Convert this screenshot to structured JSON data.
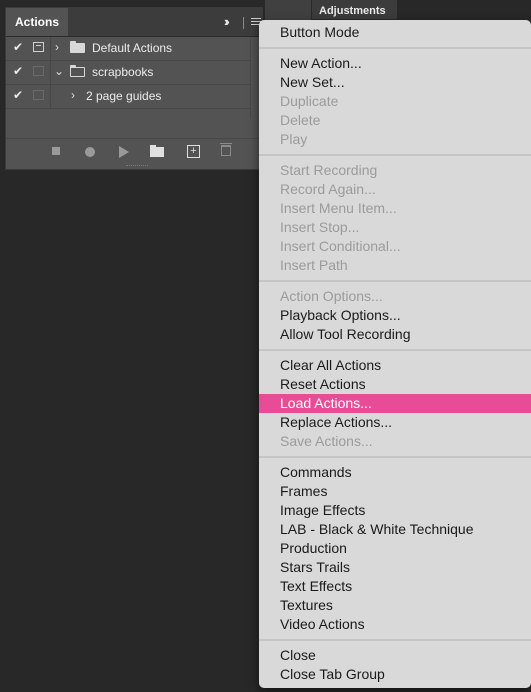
{
  "actions_panel": {
    "tab_label": "Actions",
    "rows": [
      {
        "checked": true,
        "dialog": true,
        "expanded": false,
        "kind": "set",
        "label": "Default Actions"
      },
      {
        "checked": true,
        "dialog": false,
        "expanded": true,
        "kind": "set",
        "label": "scrapbooks"
      },
      {
        "checked": true,
        "dialog": false,
        "expanded": false,
        "kind": "action",
        "label": "2 page guides"
      }
    ],
    "toolbar": {
      "stop_icon": "stop-icon",
      "record_icon": "record-icon",
      "play_icon": "play-icon",
      "new_set_icon": "folder-icon",
      "new_action_icon": "new-item-icon",
      "delete_icon": "trash-icon"
    }
  },
  "adjustments_tab": {
    "label": "Adjustments"
  },
  "menu": {
    "highlight_color": "#e84c96",
    "groups": [
      [
        {
          "label": "Button Mode",
          "enabled": true
        }
      ],
      [
        {
          "label": "New Action...",
          "enabled": true
        },
        {
          "label": "New Set...",
          "enabled": true
        },
        {
          "label": "Duplicate",
          "enabled": false
        },
        {
          "label": "Delete",
          "enabled": false
        },
        {
          "label": "Play",
          "enabled": false
        }
      ],
      [
        {
          "label": "Start Recording",
          "enabled": false
        },
        {
          "label": "Record Again...",
          "enabled": false
        },
        {
          "label": "Insert Menu Item...",
          "enabled": false
        },
        {
          "label": "Insert Stop...",
          "enabled": false
        },
        {
          "label": "Insert Conditional...",
          "enabled": false
        },
        {
          "label": "Insert Path",
          "enabled": false
        }
      ],
      [
        {
          "label": "Action Options...",
          "enabled": false
        },
        {
          "label": "Playback Options...",
          "enabled": true
        },
        {
          "label": "Allow Tool Recording",
          "enabled": true
        }
      ],
      [
        {
          "label": "Clear All Actions",
          "enabled": true
        },
        {
          "label": "Reset Actions",
          "enabled": true
        },
        {
          "label": "Load Actions...",
          "enabled": true,
          "highlighted": true
        },
        {
          "label": "Replace Actions...",
          "enabled": true
        },
        {
          "label": "Save Actions...",
          "enabled": false
        }
      ],
      [
        {
          "label": "Commands",
          "enabled": true
        },
        {
          "label": "Frames",
          "enabled": true
        },
        {
          "label": "Image Effects",
          "enabled": true
        },
        {
          "label": "LAB - Black & White Technique",
          "enabled": true
        },
        {
          "label": "Production",
          "enabled": true
        },
        {
          "label": "Stars Trails",
          "enabled": true
        },
        {
          "label": "Text Effects",
          "enabled": true
        },
        {
          "label": "Textures",
          "enabled": true
        },
        {
          "label": "Video Actions",
          "enabled": true
        }
      ],
      [
        {
          "label": "Close",
          "enabled": true
        },
        {
          "label": "Close Tab Group",
          "enabled": true
        }
      ]
    ]
  }
}
